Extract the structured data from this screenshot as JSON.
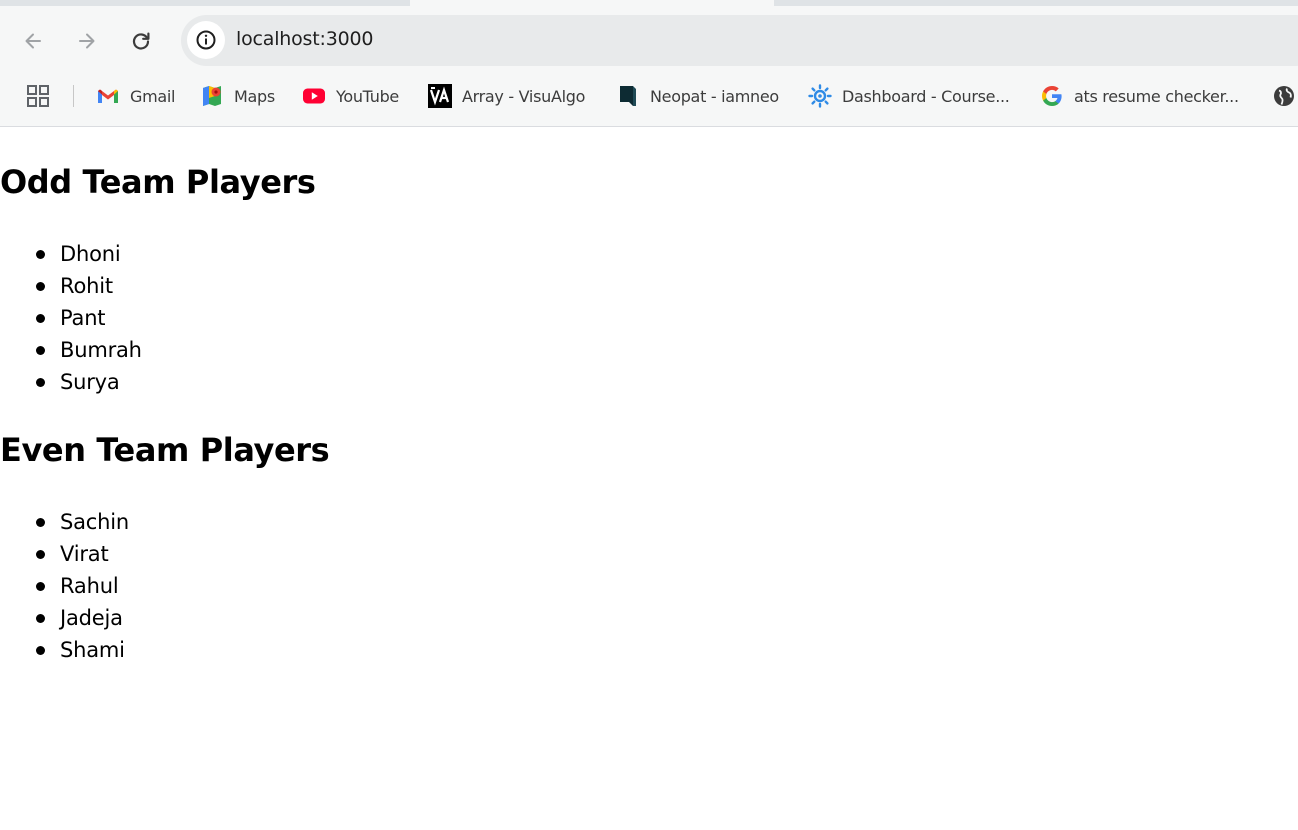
{
  "browser": {
    "url": "localhost:3000",
    "nav": {
      "back_icon": "arrow-left-icon",
      "forward_icon": "arrow-right-icon",
      "reload_icon": "reload-icon",
      "site_info_icon": "info-icon"
    },
    "bookmarks": [
      {
        "label": "Gmail",
        "icon": "gmail-icon"
      },
      {
        "label": "Maps",
        "icon": "maps-icon"
      },
      {
        "label": "YouTube",
        "icon": "youtube-icon"
      },
      {
        "label": "Array - VisuAlgo",
        "icon": "visualgo-icon"
      },
      {
        "label": "Neopat - iamneo",
        "icon": "neopat-icon"
      },
      {
        "label": "Dashboard - Course...",
        "icon": "dashboard-gear-icon"
      },
      {
        "label": "ats resume checker...",
        "icon": "google-icon"
      }
    ],
    "colors": {
      "chrome_bg": "#f6f7f7",
      "omnibox_bg": "#e8eaeb",
      "youtube_red": "#ff0033"
    }
  },
  "page": {
    "odd_heading": "Odd Team Players",
    "odd_players": [
      "Dhoni",
      "Rohit",
      "Pant",
      "Bumrah",
      "Surya"
    ],
    "even_heading": "Even Team Players",
    "even_players": [
      "Sachin",
      "Virat",
      "Rahul",
      "Jadeja",
      "Shami"
    ]
  }
}
